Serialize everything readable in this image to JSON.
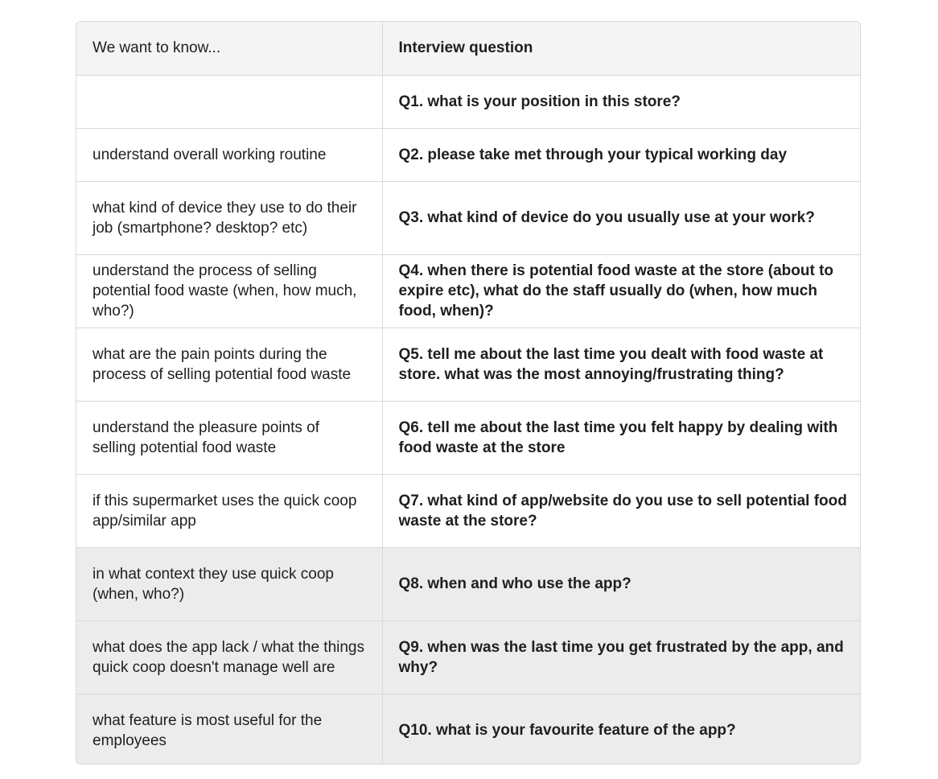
{
  "table": {
    "headers": {
      "know": "We want to know...",
      "question": "Interview question"
    },
    "rows": [
      {
        "know": "",
        "question": "Q1. what is your position in this store?"
      },
      {
        "know": "understand overall working routine",
        "question": "Q2. please take met through your typical working day"
      },
      {
        "know": "what kind of device they use to do their job (smartphone? desktop? etc)",
        "question": "Q3. what kind of device do you usually use at your work?"
      },
      {
        "know": "understand the process of selling potential food waste (when, how much, who?)",
        "question": "Q4. when there is potential food waste at the store (about to expire etc), what do the staff usually do (when, how much food, when)?"
      },
      {
        "know": "what are the pain points during the process of selling potential food waste",
        "question": "Q5. tell me about the last time you dealt with food waste at store. what was the most annoying/frustrating thing?"
      },
      {
        "know": "understand the pleasure points of selling potential food waste",
        "question": "Q6. tell me about the last time you felt happy by dealing with food waste at the store"
      },
      {
        "know": "if this supermarket uses the quick coop app/similar app",
        "question": "Q7. what kind of app/website do you use to sell potential food waste at the store?"
      },
      {
        "know": "in what context they use quick coop (when, who?)",
        "question": "Q8. when and who use the app?"
      },
      {
        "know": "what does the app lack / what the things quick coop doesn't manage well are",
        "question": "Q9. when was the last time you get frustrated by the app, and why?"
      },
      {
        "know": "what feature is most useful for the employees",
        "question": "Q10. what is your favourite feature of the app?"
      }
    ]
  }
}
